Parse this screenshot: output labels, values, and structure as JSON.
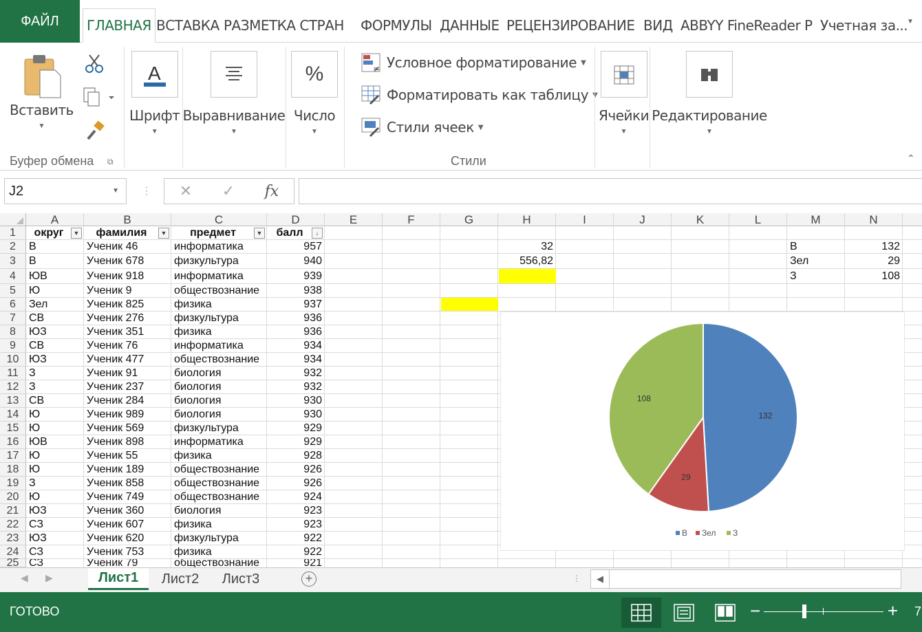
{
  "ribbon_tabs": [
    "ФАЙЛ",
    "ГЛАВНАЯ",
    "ВСТАВКА",
    "РАЗМЕТКА СТРАН",
    "ФОРМУЛЫ",
    "ДАННЫЕ",
    "РЕЦЕНЗИРОВАНИЕ",
    "ВИД",
    "ABBYY FineReader Р",
    "Учетная за..."
  ],
  "ribbon": {
    "paste": "Вставить",
    "clipboard_group": "Буфер обмена",
    "font": "Шрифт",
    "alignment": "Выравнивание",
    "number": "Число",
    "conditional_format": "Условное форматирование",
    "format_table": "Форматировать как таблицу",
    "cell_styles": "Стили ячеек",
    "styles_group": "Стили",
    "cells": "Ячейки",
    "editing": "Редактирование"
  },
  "formula_bar": {
    "name_box": "J2",
    "fx": "fx",
    "formula": ""
  },
  "columns": [
    "A",
    "B",
    "C",
    "D",
    "E",
    "F",
    "G",
    "H",
    "I",
    "J",
    "K",
    "L",
    "M",
    "N"
  ],
  "header_row": [
    "округ",
    "фамилия",
    "предмет",
    "балл"
  ],
  "rows": [
    [
      "В",
      "Ученик 46",
      "информатика",
      "957"
    ],
    [
      "В",
      "Ученик 678",
      "физкультура",
      "940"
    ],
    [
      "ЮВ",
      "Ученик 918",
      "информатика",
      "939"
    ],
    [
      "Ю",
      "Ученик 9",
      "обществознание",
      "938"
    ],
    [
      "Зел",
      "Ученик 825",
      "физика",
      "937"
    ],
    [
      "СВ",
      "Ученик 276",
      "физкультура",
      "936"
    ],
    [
      "ЮЗ",
      "Ученик 351",
      "физика",
      "936"
    ],
    [
      "СВ",
      "Ученик 76",
      "информатика",
      "934"
    ],
    [
      "ЮЗ",
      "Ученик 477",
      "обществознание",
      "934"
    ],
    [
      "З",
      "Ученик 91",
      "биология",
      "932"
    ],
    [
      "З",
      "Ученик 237",
      "биология",
      "932"
    ],
    [
      "СВ",
      "Ученик 284",
      "биология",
      "930"
    ],
    [
      "Ю",
      "Ученик 989",
      "биология",
      "930"
    ],
    [
      "Ю",
      "Ученик 569",
      "физкультура",
      "929"
    ],
    [
      "ЮВ",
      "Ученик 898",
      "информатика",
      "929"
    ],
    [
      "Ю",
      "Ученик 55",
      "физика",
      "928"
    ],
    [
      "Ю",
      "Ученик 189",
      "обществознание",
      "926"
    ],
    [
      "З",
      "Ученик 858",
      "обществознание",
      "926"
    ],
    [
      "Ю",
      "Ученик 749",
      "обществознание",
      "924"
    ],
    [
      "ЮЗ",
      "Ученик 360",
      "биология",
      "923"
    ],
    [
      "СЗ",
      "Ученик 607",
      "физика",
      "923"
    ],
    [
      "ЮЗ",
      "Ученик 620",
      "физкультура",
      "922"
    ],
    [
      "СЗ",
      "Ученик 753",
      "физика",
      "922"
    ],
    [
      "СЗ",
      "Ученик 79",
      "обществознание",
      "921"
    ]
  ],
  "h_values": {
    "h2": "32",
    "h3": "556,82"
  },
  "summary": [
    {
      "label": "В",
      "value": "132"
    },
    {
      "label": "Зел",
      "value": "29"
    },
    {
      "label": "З",
      "value": "108"
    }
  ],
  "chart_data": {
    "type": "pie",
    "categories": [
      "В",
      "Зел",
      "З"
    ],
    "values": [
      132,
      29,
      108
    ],
    "colors": [
      "#4f81bd",
      "#c0504d",
      "#9bbb59"
    ],
    "legend": "bottom"
  },
  "sheets": [
    "Лист1",
    "Лист2",
    "Лист3"
  ],
  "status": {
    "text": "ГОТОВО",
    "zoom": "7"
  }
}
